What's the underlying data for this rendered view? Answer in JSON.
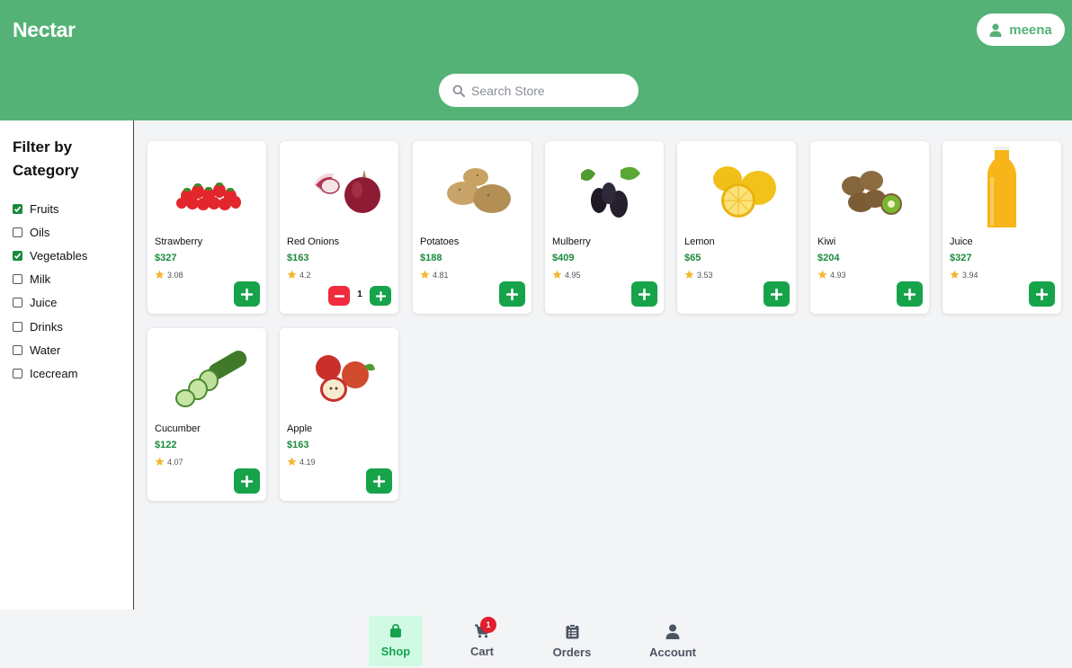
{
  "header": {
    "brand": "Nectar",
    "user_name": "meena"
  },
  "search": {
    "placeholder": "Search Store",
    "value": ""
  },
  "sidebar": {
    "title": "Filter by Category",
    "categories": [
      {
        "label": "Fruits",
        "checked": true
      },
      {
        "label": "Oils",
        "checked": false
      },
      {
        "label": "Vegetables",
        "checked": true
      },
      {
        "label": "Milk",
        "checked": false
      },
      {
        "label": "Juice",
        "checked": false
      },
      {
        "label": "Drinks",
        "checked": false
      },
      {
        "label": "Water",
        "checked": false
      },
      {
        "label": "Icecream",
        "checked": false
      }
    ]
  },
  "products": [
    {
      "name": "Strawberry",
      "price": "$327",
      "rating": "3.08",
      "icon": "strawberry-icon"
    },
    {
      "name": "Red Onions",
      "price": "$163",
      "rating": "4.2",
      "icon": "red-onion-icon",
      "quantity": "1"
    },
    {
      "name": "Potatoes",
      "price": "$188",
      "rating": "4.81",
      "icon": "potato-icon"
    },
    {
      "name": "Mulberry",
      "price": "$409",
      "rating": "4.95",
      "icon": "mulberry-icon"
    },
    {
      "name": "Lemon",
      "price": "$65",
      "rating": "3.53",
      "icon": "lemon-icon"
    },
    {
      "name": "Kiwi",
      "price": "$204",
      "rating": "4.93",
      "icon": "kiwi-icon"
    },
    {
      "name": "Juice",
      "price": "$327",
      "rating": "3.94",
      "icon": "juice-bottle-icon"
    },
    {
      "name": "Cucumber",
      "price": "$122",
      "rating": "4.07",
      "icon": "cucumber-icon"
    },
    {
      "name": "Apple",
      "price": "$163",
      "rating": "4.19",
      "icon": "apple-icon"
    }
  ],
  "bottom_nav": {
    "items": [
      {
        "label": "Shop",
        "icon": "shopping-bag-icon",
        "active": true
      },
      {
        "label": "Cart",
        "icon": "cart-icon",
        "active": false
      },
      {
        "label": "Orders",
        "icon": "clipboard-list-icon",
        "active": false
      },
      {
        "label": "Account",
        "icon": "user-icon",
        "active": false
      }
    ],
    "cart_badge": "1"
  },
  "colors": {
    "primary": "#55b276",
    "accent_green": "#16a34a",
    "danger": "#ef2b3d",
    "price": "#1a8a3c",
    "star": "#f5b731"
  }
}
